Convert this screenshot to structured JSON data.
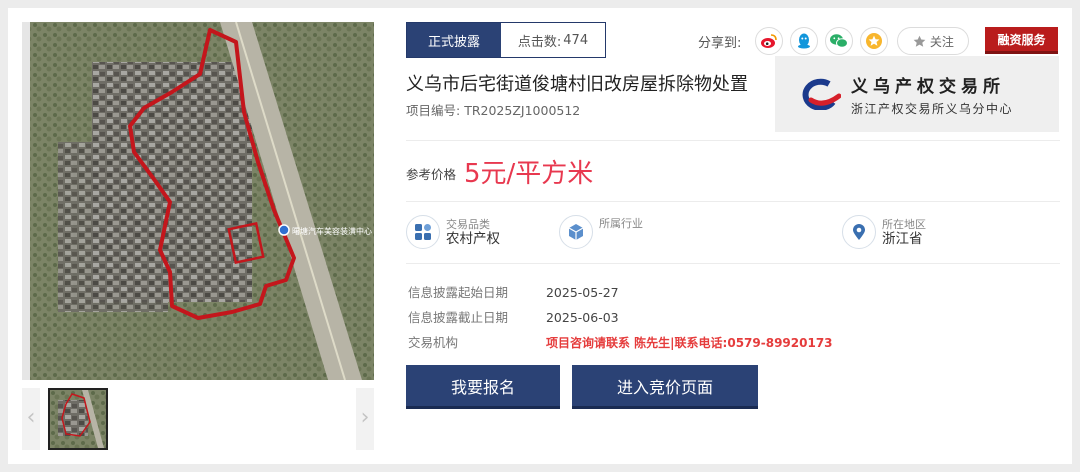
{
  "gallery": {
    "prev_arrow": "‹",
    "next_arrow": "›"
  },
  "status_tab": {
    "status": "正式披露",
    "clicks_label": "点击数:",
    "clicks_value": "474"
  },
  "share": {
    "label": "分享到:",
    "buttons": [
      "weibo-icon",
      "qq-icon",
      "wechat-icon",
      "favorite-icon"
    ],
    "follow_label": "关注",
    "finance_label": "融资服务"
  },
  "project": {
    "title": "义乌市后宅街道俊塘村旧改房屋拆除物处置",
    "number_label": "项目编号:",
    "number": "TR2025ZJ1000512"
  },
  "org": {
    "name": "义乌产权交易所",
    "subtitle": "浙江产权交易所义乌分中心"
  },
  "price": {
    "label": "参考价格",
    "value": "5元/平方米"
  },
  "attributes": [
    {
      "title": "交易品类",
      "value": "农村产权",
      "icon": "category-icon"
    },
    {
      "title": "所属行业",
      "value": "",
      "icon": "cube-icon"
    },
    {
      "title": "所在地区",
      "value": "浙江省",
      "icon": "location-pin-icon"
    }
  ],
  "info": {
    "start_label": "信息披露起始日期",
    "start_value": "2025-05-27",
    "end_label": "信息披露截止日期",
    "end_value": "2025-06-03",
    "agency_label": "交易机构",
    "agency_value": "项目咨询请联系 陈先生|联系电话:0579-89920173"
  },
  "map_labels": {
    "poi": "曙塘汽车美容装潢中心"
  },
  "actions": {
    "register": "我要报名",
    "bidding": "进入竞价页面"
  },
  "colors": {
    "brand_navy": "#2b4275",
    "price_red": "#e8384f",
    "finance_red": "#b91c1c"
  }
}
